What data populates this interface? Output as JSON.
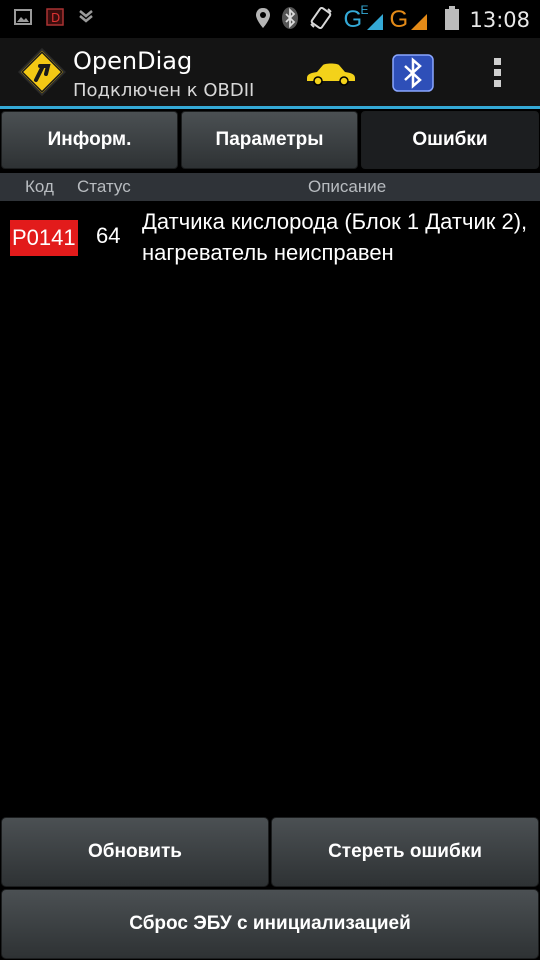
{
  "status_bar": {
    "time": "13:08",
    "network_labels": [
      "G",
      "E",
      "G"
    ],
    "icons": [
      "gallery-icon",
      "app-notification-icon",
      "download-icon",
      "location-icon",
      "bluetooth-icon",
      "vibrate-icon",
      "signal-icon",
      "battery-icon"
    ]
  },
  "app": {
    "title": "OpenDiag",
    "subtitle": "Подключен к OBDII",
    "accent_color": "#34a9d6"
  },
  "tabs": [
    {
      "label": "Информ.",
      "active": false
    },
    {
      "label": "Параметры",
      "active": false
    },
    {
      "label": "Ошибки",
      "active": true
    }
  ],
  "columns": {
    "code": "Код",
    "status": "Статус",
    "description": "Описание"
  },
  "errors": [
    {
      "code": "P0141",
      "status": "64",
      "description": "Датчика кислорода (Блок 1 Датчик 2), нагреватель неисправен"
    }
  ],
  "buttons": {
    "refresh": "Обновить",
    "clear_errors": "Стереть ошибки",
    "ecu_reset": "Сброс ЭБУ с инициализацией"
  },
  "colors": {
    "error_code_bg": "#e21b1b",
    "car_icon": "#f3d21a"
  }
}
